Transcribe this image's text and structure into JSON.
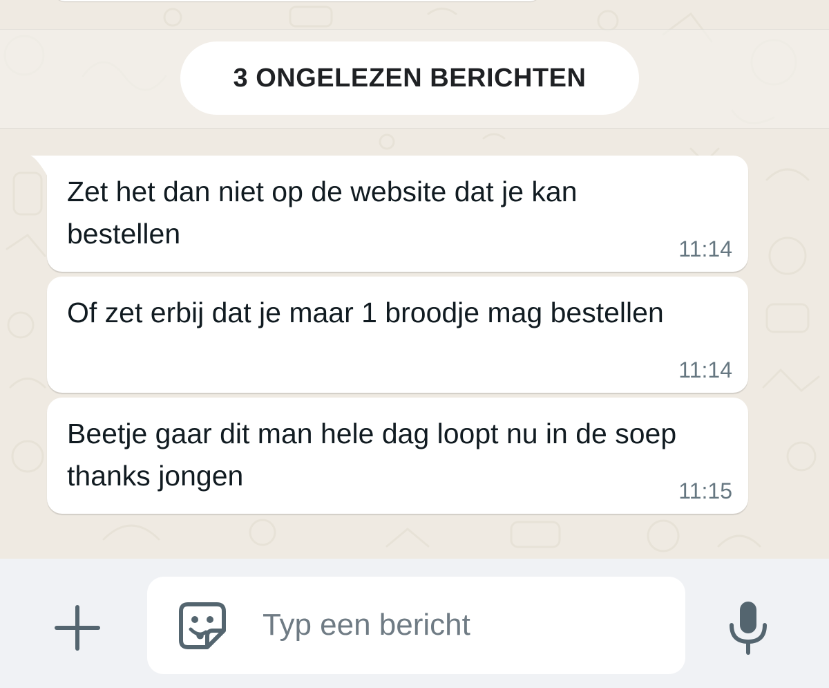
{
  "unread_divider": {
    "label": "3 ONGELEZEN BERICHTEN"
  },
  "messages": [
    {
      "text": "Zet het dan niet op de website dat je kan bestellen",
      "time": "11:14"
    },
    {
      "text": "Of zet erbij dat je maar 1 broodje mag bestellen",
      "time": "11:14"
    },
    {
      "text": "Beetje gaar dit man hele dag loopt nu in de soep thanks jongen",
      "time": "11:15"
    }
  ],
  "composer": {
    "placeholder": "Typ een bericht",
    "attach_icon": "plus-icon",
    "sticker_icon": "sticker-icon",
    "voice_icon": "microphone-icon"
  },
  "colors": {
    "wallpaper": "#efeae2",
    "bubble": "#ffffff",
    "text": "#111b21",
    "timestamp": "#667781",
    "composer_bar": "#f0f2f5",
    "icon": "#54656f"
  }
}
